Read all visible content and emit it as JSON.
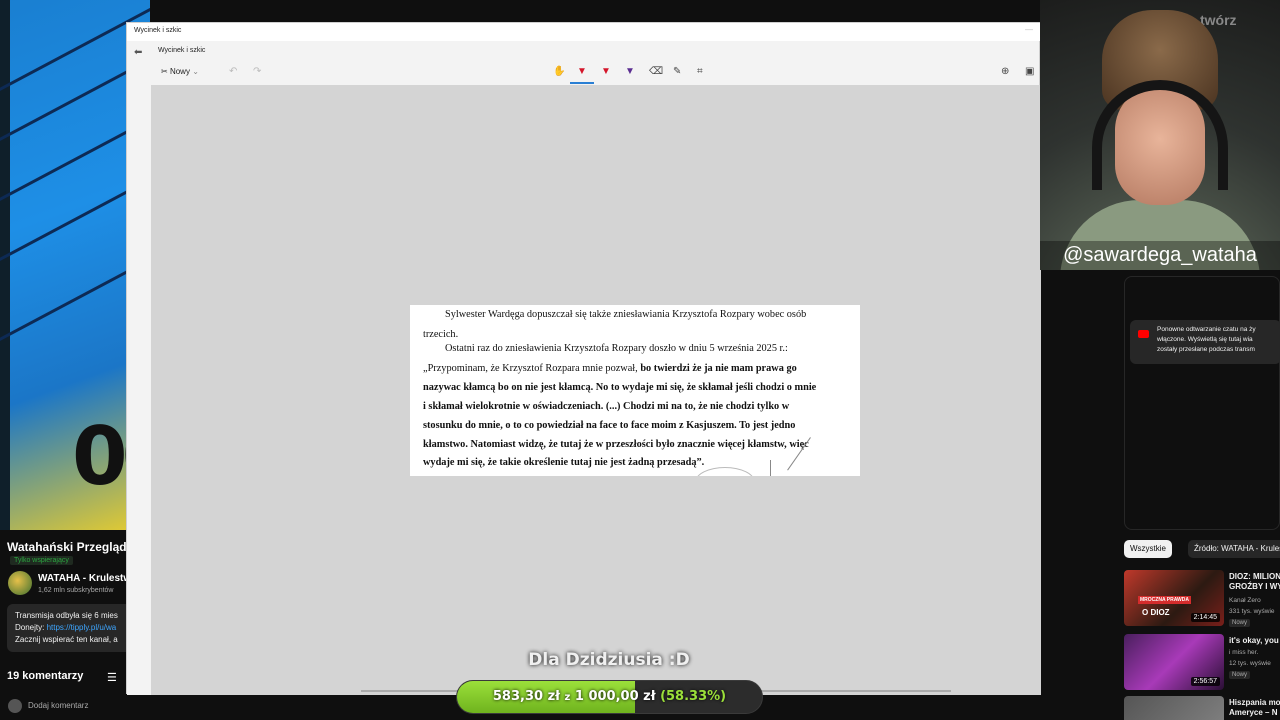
{
  "left_panel": {
    "video_title": "Watahański Przegląd",
    "members_badge": "Tylko wspierający",
    "channel_name": "WATAHA - Krulestwo",
    "subscribers": "1,62 mln subskrybentów",
    "description": {
      "line1": "Transmisja odbyła się 6 mies",
      "line2_prefix": "Donejty: ",
      "line2_link": "https://tipply.pl/u/wa",
      "line3": "Zacznij wspierać ten kanał, a"
    },
    "comments_count": "19 komentarzy",
    "add_comment_placeholder": "Dodaj komentarz",
    "video_overlay_text": "00"
  },
  "window": {
    "title": "Wycinek i szkic",
    "app_label": "Wycinek i szkic",
    "toolbar": {
      "new_label": "Nowy",
      "icons": [
        "touch-writing-icon",
        "ballpoint-pen-icon",
        "pencil-icon",
        "highlighter-icon",
        "eraser-icon",
        "ruler-icon",
        "crop-icon",
        "zoom-icon",
        "save-icon"
      ]
    }
  },
  "document": {
    "lines": [
      "Sylwester Wardęga dopuszczał się także zniesławiania Krzysztofa Rozpary wobec osób",
      "trzecich.",
      "Ostatni raz do zniesławienia Krzysztofa Rozpary doszło w dniu 5 września 2025 r.:",
      "„Przypominam, że Krzysztof Rozpara mnie pozwał,",
      "bo twierdzi że ja nie mam prawa go",
      "nazywac kłamcą bo on nie jest kłamcą. No to wydaje mi się, że skłamał jeśli chodzi o mnie",
      "i skłamał wielokrotnie w oświadczeniach. (...) Chodzi mi na to, że nie chodzi tylko w",
      "stosunku do mnie, o to co powiedział na face to face moim z Kasjuszem. To jest jedno",
      "kłamstwo. Natomiast widzę, że tutaj że w przeszłości było znacznie więcej kłamstw, więc",
      "wydaje mi się, że takie określenie tutaj nie jest żadną przesadą”."
    ]
  },
  "webcam": {
    "handle": "@sawardega_wataha",
    "corner_text": "twórz"
  },
  "right_panel": {
    "chat_notice": [
      "Ponowne odtwarzanie czatu na ży",
      "włączone. Wyświetlą się tutaj wia",
      "zostały przesłane podczas transm"
    ],
    "chips": [
      "Wszystkie",
      "Źródło: WATAHA - Krules"
    ],
    "recommendations": [
      {
        "title1": "DIOZ: MILION",
        "title2": "GROŹBY I WY",
        "channel": "Kanał Zero",
        "views": "331 tys. wyświe",
        "badge": "Nowy",
        "duration": "2:14:45",
        "thumb_tag": "MROCZNA PRAWDA",
        "thumb_sub": "O DIOZ"
      },
      {
        "title1": "it's okay, you s",
        "channel": "i miss her.",
        "views": "12 tys. wyświe",
        "badge": "Nowy",
        "duration": "2:56:57"
      },
      {
        "title1": "Hiszpania mo",
        "title2": "Ameryce – N"
      }
    ]
  },
  "donation": {
    "message": "Dla Dzidziusia :D",
    "current": "583,30 zł",
    "separator": "z",
    "goal": "1 000,00 zł",
    "percent_label": "(58.33%)",
    "progress": 0.5833,
    "fill_color": "#8bd42e"
  }
}
